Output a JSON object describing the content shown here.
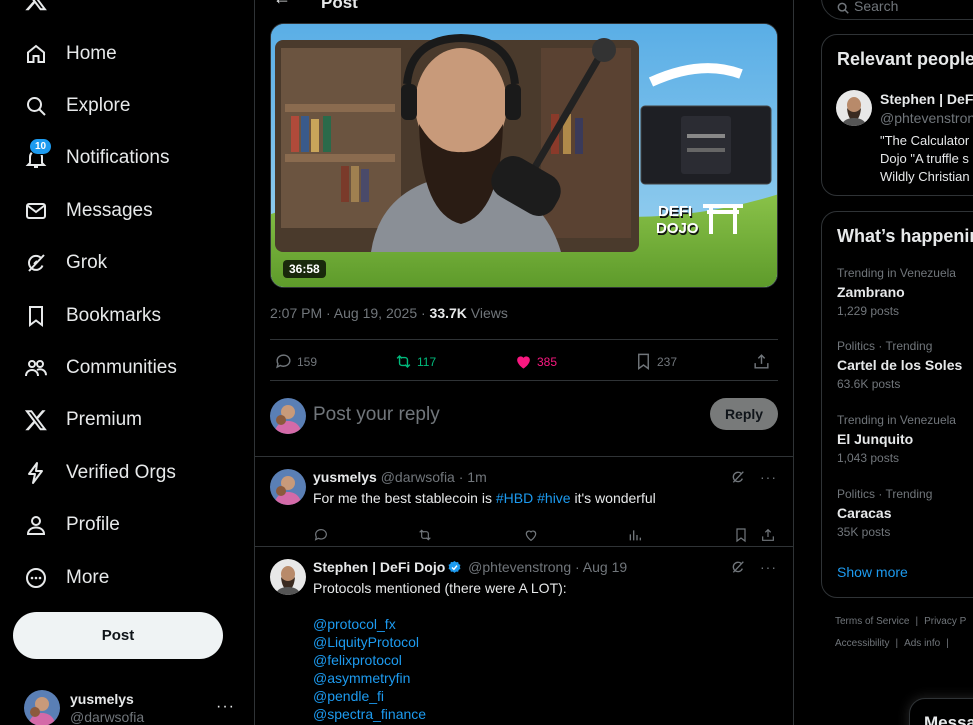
{
  "sidebar": {
    "nav": [
      {
        "label": "Home",
        "icon": "home-icon"
      },
      {
        "label": "Explore",
        "icon": "search-icon"
      },
      {
        "label": "Notifications",
        "icon": "bell-icon",
        "badge": "10"
      },
      {
        "label": "Messages",
        "icon": "envelope-icon"
      },
      {
        "label": "Grok",
        "icon": "grok-icon"
      },
      {
        "label": "Bookmarks",
        "icon": "bookmark-icon"
      },
      {
        "label": "Communities",
        "icon": "people-icon"
      },
      {
        "label": "Premium",
        "icon": "x-logo-icon"
      },
      {
        "label": "Verified Orgs",
        "icon": "lightning-icon"
      },
      {
        "label": "Profile",
        "icon": "person-icon"
      },
      {
        "label": "More",
        "icon": "more-circle-icon"
      }
    ],
    "post_button": "Post",
    "account": {
      "name": "yusmelys",
      "handle": "@darwsofia"
    }
  },
  "main": {
    "header_title": "Post",
    "media": {
      "duration": "36:58",
      "brand_text": "DEFI DOJO"
    },
    "meta": {
      "time": "2:07 PM · Aug 19, 2025 · ",
      "views_count": "33.7K",
      "views_label": " Views"
    },
    "actions": {
      "replies": "159",
      "reposts": "117",
      "likes": "385",
      "bookmarks": "237"
    },
    "reply_placeholder": "Post your reply",
    "reply_button": "Reply",
    "tweets": [
      {
        "name": "yusmelys",
        "handle": "@darwsofia · 1m",
        "text_before": "For me the best stablecoin is ",
        "hashtag1": "#HBD",
        "hashtag2": "#hive",
        "text_after": " it's wonderful"
      },
      {
        "name": "Stephen | DeFi Dojo",
        "handle": "@phtevenstrong · Aug 19",
        "text": "Protocols mentioned (there were A LOT):",
        "mentions": [
          "@protocol_fx",
          "@LiquityProtocol",
          "@felixprotocol",
          "@asymmetryfin",
          "@pendle_fi",
          "@spectra_finance"
        ]
      }
    ]
  },
  "right": {
    "search_placeholder": "Search",
    "relevant": {
      "title": "Relevant people",
      "name": "Stephen | DeFi",
      "handle": "@phtevenstrong",
      "bio_lines": [
        "\"The Calculator",
        "Dojo \"A truffle s",
        "Wildly Christian"
      ]
    },
    "happening": {
      "title": "What’s happening",
      "trends": [
        {
          "context": "Trending in Venezuela",
          "topic": "Zambrano",
          "count": "1,229 posts"
        },
        {
          "context": "Politics · Trending",
          "topic": "Cartel de los Soles",
          "count": "63.6K posts"
        },
        {
          "context": "Trending in Venezuela",
          "topic": "El Junquito",
          "count": "1,043 posts"
        },
        {
          "context": "Politics · Trending",
          "topic": "Caracas",
          "count": "35K posts"
        }
      ],
      "show_more": "Show more"
    },
    "footer_line1": [
      "Terms of Service",
      "Privacy P"
    ],
    "footer_line2": [
      "Accessibility",
      "Ads info"
    ],
    "messages_drawer": "Messa"
  },
  "colors": {
    "accent": "#1d9bf0",
    "like": "#f91880",
    "repost": "#00ba7c",
    "border": "#2f3336",
    "muted": "#71767b"
  }
}
